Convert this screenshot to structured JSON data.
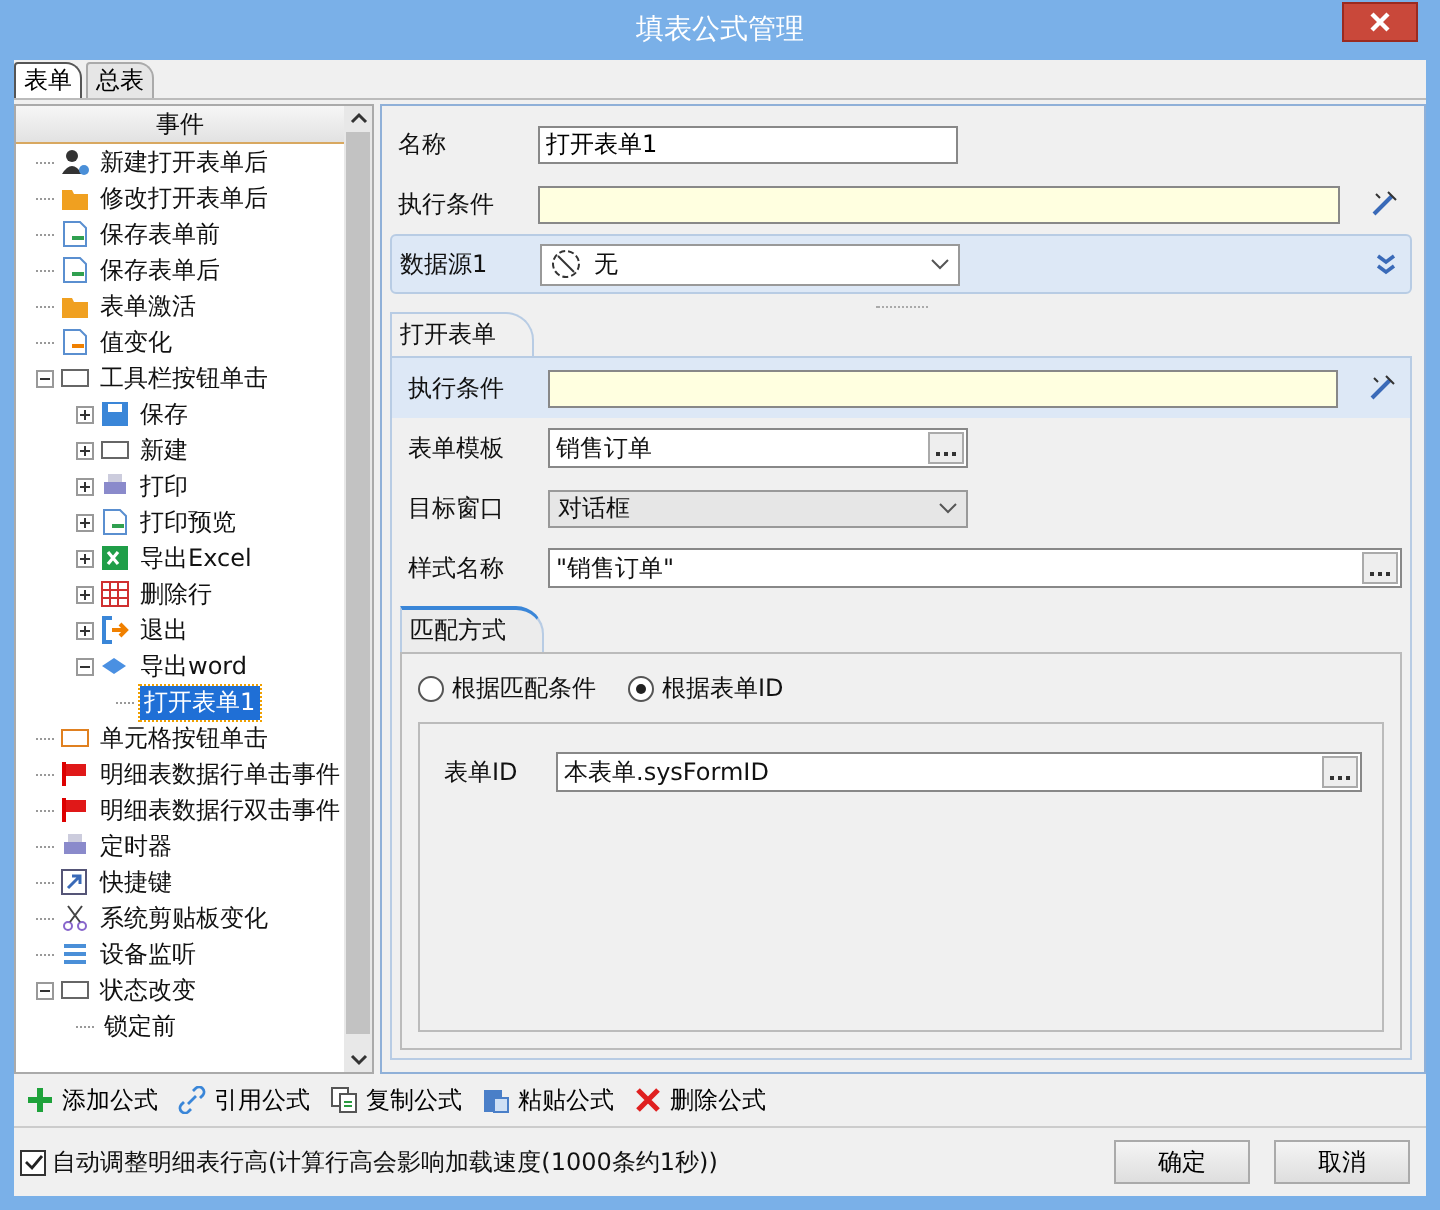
{
  "window": {
    "title": "填表公式管理"
  },
  "tabs": [
    {
      "label": "表单",
      "selected": true
    },
    {
      "label": "总表",
      "selected": false
    }
  ],
  "tree": {
    "header": "事件",
    "items": [
      {
        "label": "新建打开表单后",
        "selected": false
      },
      {
        "label": "修改打开表单后",
        "selected": false
      },
      {
        "label": "保存表单前",
        "selected": false
      },
      {
        "label": "保存表单后",
        "selected": false
      },
      {
        "label": "表单激活",
        "selected": false
      },
      {
        "label": "值变化",
        "selected": false
      },
      {
        "label": "工具栏按钮单击",
        "selected": false,
        "expanded": true,
        "children": [
          {
            "label": "保存",
            "selected": false,
            "expanded": false
          },
          {
            "label": "新建",
            "selected": false,
            "expanded": false
          },
          {
            "label": "打印",
            "selected": false,
            "expanded": false
          },
          {
            "label": "打印预览",
            "selected": false,
            "expanded": false
          },
          {
            "label": "导出Excel",
            "selected": false,
            "expanded": false
          },
          {
            "label": "删除行",
            "selected": false,
            "expanded": false
          },
          {
            "label": "退出",
            "selected": false,
            "expanded": false
          },
          {
            "label": "导出word",
            "selected": false,
            "expanded": true,
            "children": [
              {
                "label": "打开表单1",
                "selected": true
              }
            ]
          }
        ]
      },
      {
        "label": "单元格按钮单击",
        "selected": false
      },
      {
        "label": "明细表数据行单击事件",
        "selected": false
      },
      {
        "label": "明细表数据行双击事件",
        "selected": false
      },
      {
        "label": "定时器",
        "selected": false
      },
      {
        "label": "快捷键",
        "selected": false
      },
      {
        "label": "系统剪贴板变化",
        "selected": false
      },
      {
        "label": "设备监听",
        "selected": false
      },
      {
        "label": "状态改变",
        "selected": false,
        "expanded": true,
        "children": [
          {
            "label": "锁定前",
            "selected": false
          }
        ]
      }
    ]
  },
  "form": {
    "name": {
      "label": "名称",
      "value": "打开表单1"
    },
    "condition": {
      "label": "执行条件"
    },
    "datasource": {
      "label": "数据源1",
      "value": "无"
    },
    "open_form": {
      "tab": "打开表单",
      "condition": {
        "label": "执行条件"
      },
      "template": {
        "label": "表单模板",
        "value": "销售订单"
      },
      "target_window": {
        "label": "目标窗口",
        "value": "对话框"
      },
      "style_name": {
        "label": "样式名称",
        "value": "\"销售订单\""
      },
      "match": {
        "tab": "匹配方式",
        "radios": [
          {
            "label": "根据匹配条件",
            "selected": false
          },
          {
            "label": "根据表单ID",
            "selected": true
          }
        ],
        "form_id": {
          "label": "表单ID",
          "value": "本表单.sysFormID"
        }
      }
    }
  },
  "toolbar": [
    {
      "kind": "add",
      "label": "添加公式"
    },
    {
      "kind": "link",
      "label": "引用公式"
    },
    {
      "kind": "copy",
      "label": "复制公式"
    },
    {
      "kind": "paste",
      "label": "粘贴公式"
    },
    {
      "kind": "delete",
      "label": "删除公式"
    }
  ],
  "footer": {
    "auto_height": {
      "label": "自动调整明细表行高(计算行高会影响加载速度(1000条约1秒))",
      "checked": true
    },
    "buttons": [
      "确定",
      "取消"
    ]
  }
}
